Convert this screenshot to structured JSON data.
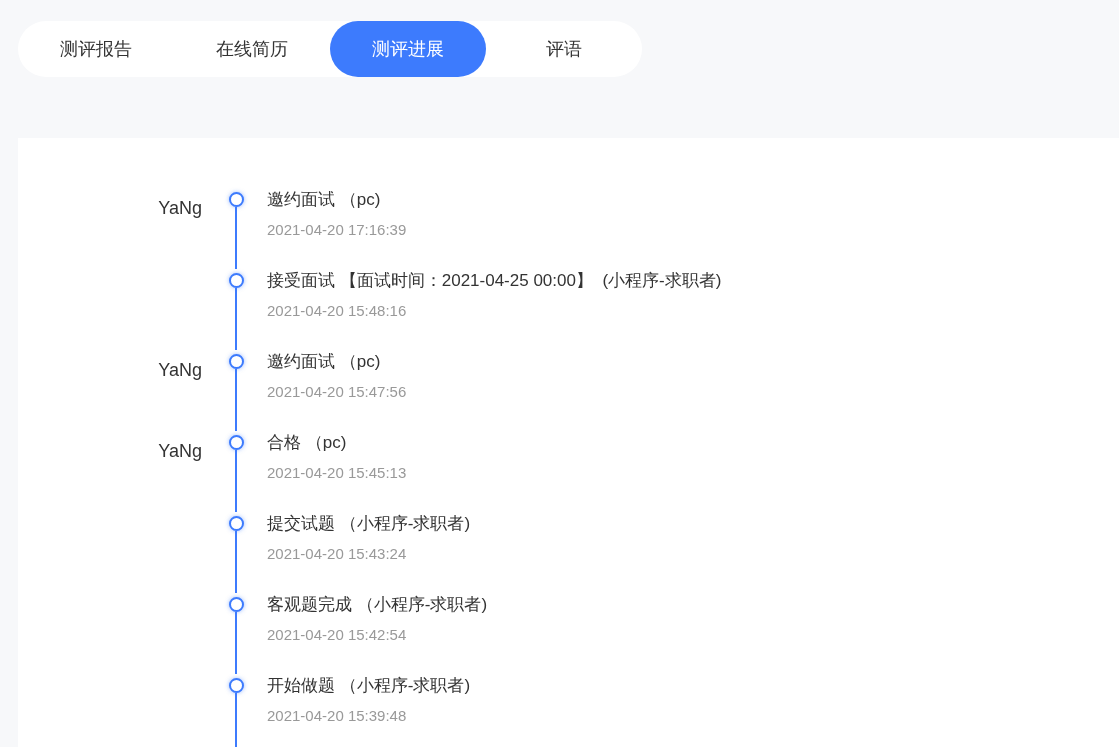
{
  "tabs": [
    {
      "label": "测评报告",
      "selected": false
    },
    {
      "label": "在线简历",
      "selected": false
    },
    {
      "label": "测评进展",
      "selected": true
    },
    {
      "label": "评语",
      "selected": false
    }
  ],
  "timeline": [
    {
      "operator": "YaNg",
      "title": "邀约面试 （pc)",
      "time": "2021-04-20 17:16:39"
    },
    {
      "title": "接受面试 【面试时间：2021-04-25 00:00】  (小程序-求职者)",
      "time": "2021-04-20 15:48:16"
    },
    {
      "operator": "YaNg",
      "title": "邀约面试 （pc)",
      "time": "2021-04-20 15:47:56"
    },
    {
      "operator": "YaNg",
      "title": "合格 （pc)",
      "time": "2021-04-20 15:45:13"
    },
    {
      "title": "提交试题 （小程序-求职者)",
      "time": "2021-04-20 15:43:24"
    },
    {
      "title": "客观题完成 （小程序-求职者)",
      "time": "2021-04-20 15:42:54"
    },
    {
      "title": "开始做题 （小程序-求职者)",
      "time": "2021-04-20 15:39:48"
    }
  ]
}
